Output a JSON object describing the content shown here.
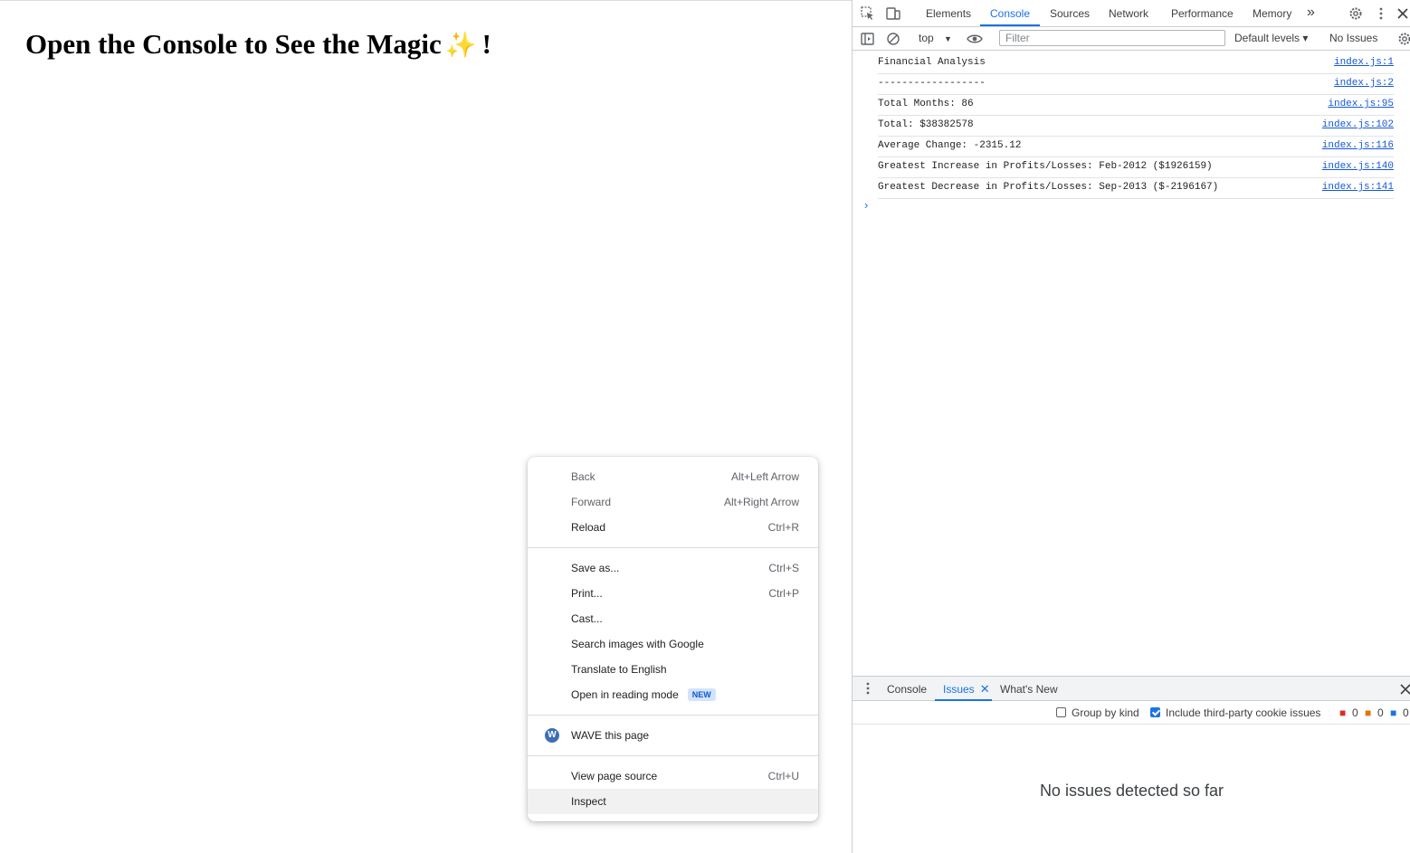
{
  "page": {
    "heading": "Open the Console to See the Magic",
    "sparkle": "✨",
    "exclaim": "!"
  },
  "devtools": {
    "tabs": [
      "Elements",
      "Console",
      "Sources",
      "Network",
      "Performance",
      "Memory"
    ],
    "active_tab": "Console",
    "more_tabs": "»",
    "toolbar": {
      "context": "top",
      "filter_placeholder": "Filter",
      "levels": "Default levels ▾",
      "issues": "No Issues"
    },
    "logs": [
      {
        "msg": "Financial Analysis",
        "src": "index.js:1"
      },
      {
        "msg": "------------------",
        "src": "index.js:2"
      },
      {
        "msg": "Total Months: 86",
        "src": "index.js:95"
      },
      {
        "msg": "Total: $38382578",
        "src": "index.js:102"
      },
      {
        "msg": "Average Change: -2315.12",
        "src": "index.js:116"
      },
      {
        "msg": "Greatest Increase in Profits/Losses: Feb-2012 ($1926159)",
        "src": "index.js:140"
      },
      {
        "msg": "Greatest Decrease in Profits/Losses: Sep-2013 ($-2196167)",
        "src": "index.js:141"
      }
    ],
    "prompt": "›",
    "drawer": {
      "tabs": [
        "Console",
        "Issues",
        "What's New"
      ],
      "group_by_kind": "Group by kind",
      "third_party": "Include third-party cookie issues",
      "counts": [
        "0",
        "0",
        "0"
      ],
      "empty_message": "No issues detected so far"
    }
  },
  "context_menu": {
    "items": [
      {
        "label": "Back",
        "shortcut": "Alt+Left Arrow"
      },
      {
        "label": "Forward",
        "shortcut": "Alt+Right Arrow"
      },
      {
        "label": "Reload",
        "shortcut": "Ctrl+R"
      },
      {
        "label": "Save as...",
        "shortcut": "Ctrl+S"
      },
      {
        "label": "Print...",
        "shortcut": "Ctrl+P"
      },
      {
        "label": "Cast...",
        "shortcut": ""
      },
      {
        "label": "Search images with Google",
        "shortcut": ""
      },
      {
        "label": "Translate to English",
        "shortcut": ""
      },
      {
        "label": "Open in reading mode",
        "shortcut": "",
        "badge": "NEW"
      },
      {
        "label": "WAVE this page",
        "shortcut": ""
      },
      {
        "label": "View page source",
        "shortcut": "Ctrl+U"
      },
      {
        "label": "Inspect",
        "shortcut": ""
      }
    ]
  },
  "colors": {
    "accent": "#1a73e8",
    "link": "#1558d6",
    "hover": "#f1f1f1"
  },
  "icons": [
    "inspect-icon",
    "device-toggle-icon",
    "settings-icon",
    "kebab-icon",
    "close-icon",
    "sidebar-icon",
    "clear-icon",
    "eye-icon",
    "wave-icon"
  ]
}
